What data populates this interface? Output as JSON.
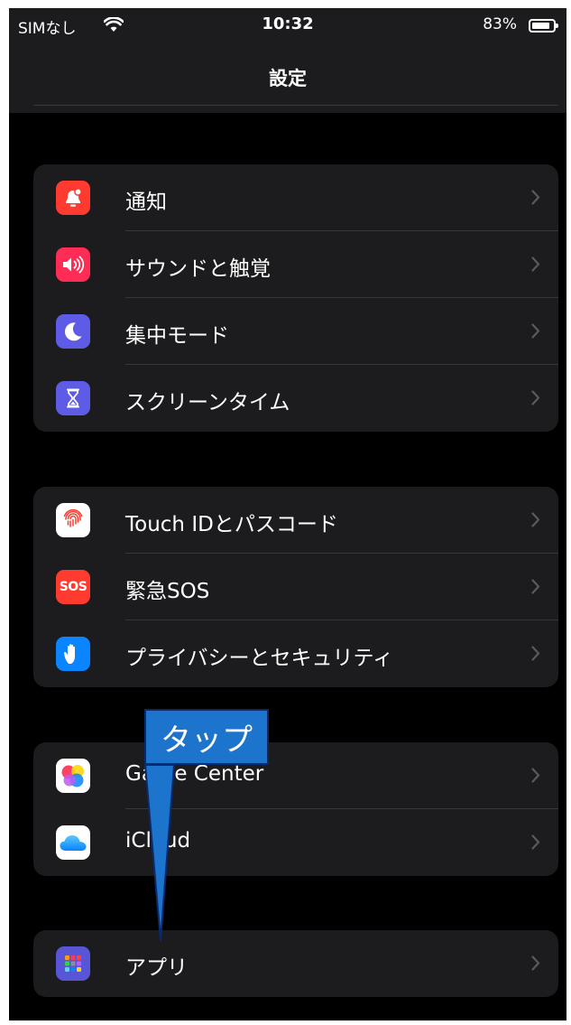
{
  "status_bar": {
    "carrier": "SIMなし",
    "time": "10:32",
    "battery_percent": "83%",
    "battery_level": 0.83
  },
  "nav": {
    "title": "設定"
  },
  "groups": [
    {
      "items": [
        {
          "label": "通知",
          "icon": "notifications-icon",
          "color": "#ff3b30"
        },
        {
          "label": "サウンドと触覚",
          "icon": "sound-icon",
          "color": "#ff2d55"
        },
        {
          "label": "集中モード",
          "icon": "focus-moon-icon",
          "color": "#5e5ce6"
        },
        {
          "label": "スクリーンタイム",
          "icon": "screen-time-hourglass-icon",
          "color": "#5e5ce6"
        }
      ]
    },
    {
      "items": [
        {
          "label": "Touch IDとパスコード",
          "icon": "fingerprint-icon",
          "color": "#ffffff"
        },
        {
          "label": "緊急SOS",
          "icon": "sos-icon",
          "color": "#ff3b30",
          "icon_text": "SOS"
        },
        {
          "label": "プライバシーとセキュリティ",
          "icon": "privacy-hand-icon",
          "color": "#0a84ff"
        }
      ]
    },
    {
      "items": [
        {
          "label": "Game Center",
          "icon": "game-center-icon",
          "color": "#ffffff"
        },
        {
          "label": "iCloud",
          "icon": "icloud-icon",
          "color": "#ffffff"
        }
      ]
    },
    {
      "items": [
        {
          "label": "アプリ",
          "icon": "apps-grid-icon",
          "color": "#5856d6"
        }
      ]
    }
  ],
  "annotation": {
    "text": "タップ",
    "color": "#1d74cc"
  }
}
